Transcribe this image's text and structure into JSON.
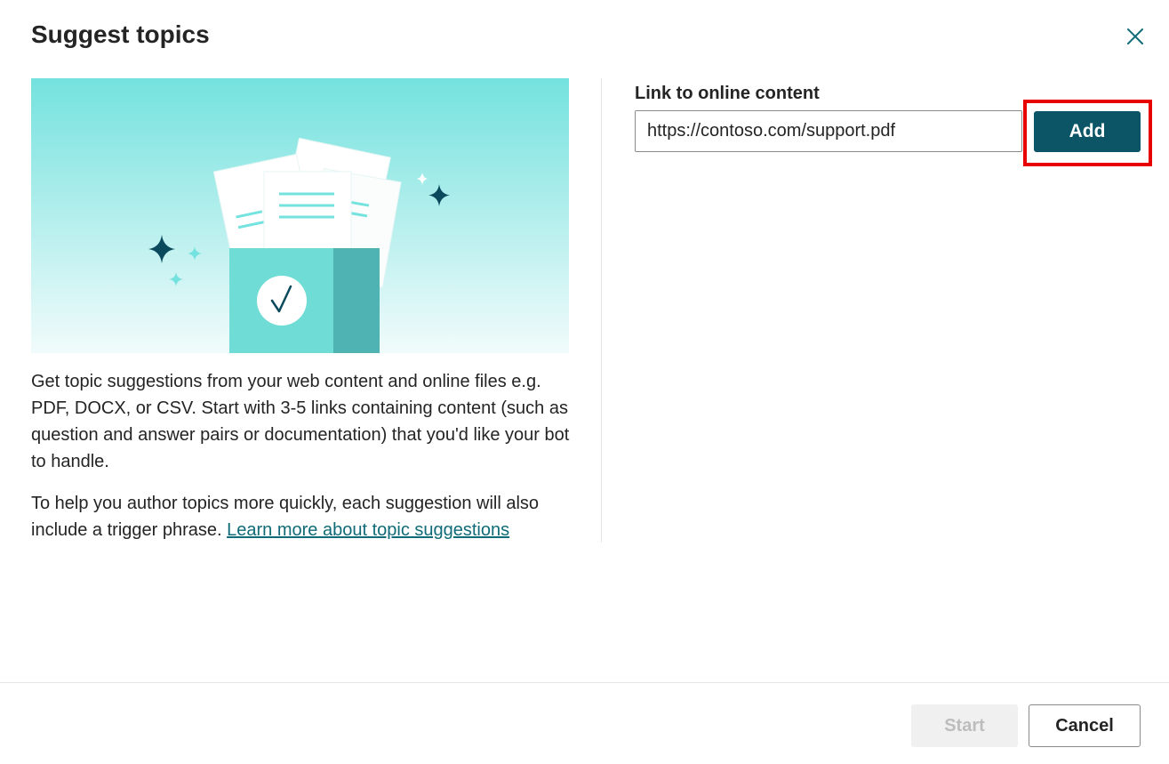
{
  "dialog": {
    "title": "Suggest topics",
    "close_icon": "close-icon"
  },
  "illustration": {
    "icon": "documents-box-checkmark-icon",
    "colors": {
      "gradient_top": "#74e2de",
      "gradient_bottom": "#f1fbfb",
      "box": "#6fdcd6",
      "box_side": "#4fb3b3",
      "sparkle_dark": "#0b4a5c",
      "sparkle_light": "#74e2de",
      "check": "#0b4a5c"
    }
  },
  "description": {
    "paragraph1": "Get topic suggestions from your web content and online files e.g. PDF, DOCX, or CSV. Start with 3-5 links containing content (such as question and answer pairs or documentation) that you'd like your bot to handle.",
    "paragraph2_text": "To help you author topics more quickly, each suggestion will also include a trigger phrase. ",
    "learn_more_link": "Learn more about topic suggestions"
  },
  "link_input": {
    "label": "Link to online content",
    "value": "https://contoso.com/support.pdf",
    "add_button": "Add"
  },
  "footer": {
    "start_button": "Start",
    "cancel_button": "Cancel"
  },
  "colors": {
    "primary": "#0b5566",
    "link": "#0f6b77",
    "highlight_border": "#e80000",
    "disabled_bg": "#f0f0f0",
    "disabled_text": "#bdbdbd"
  }
}
